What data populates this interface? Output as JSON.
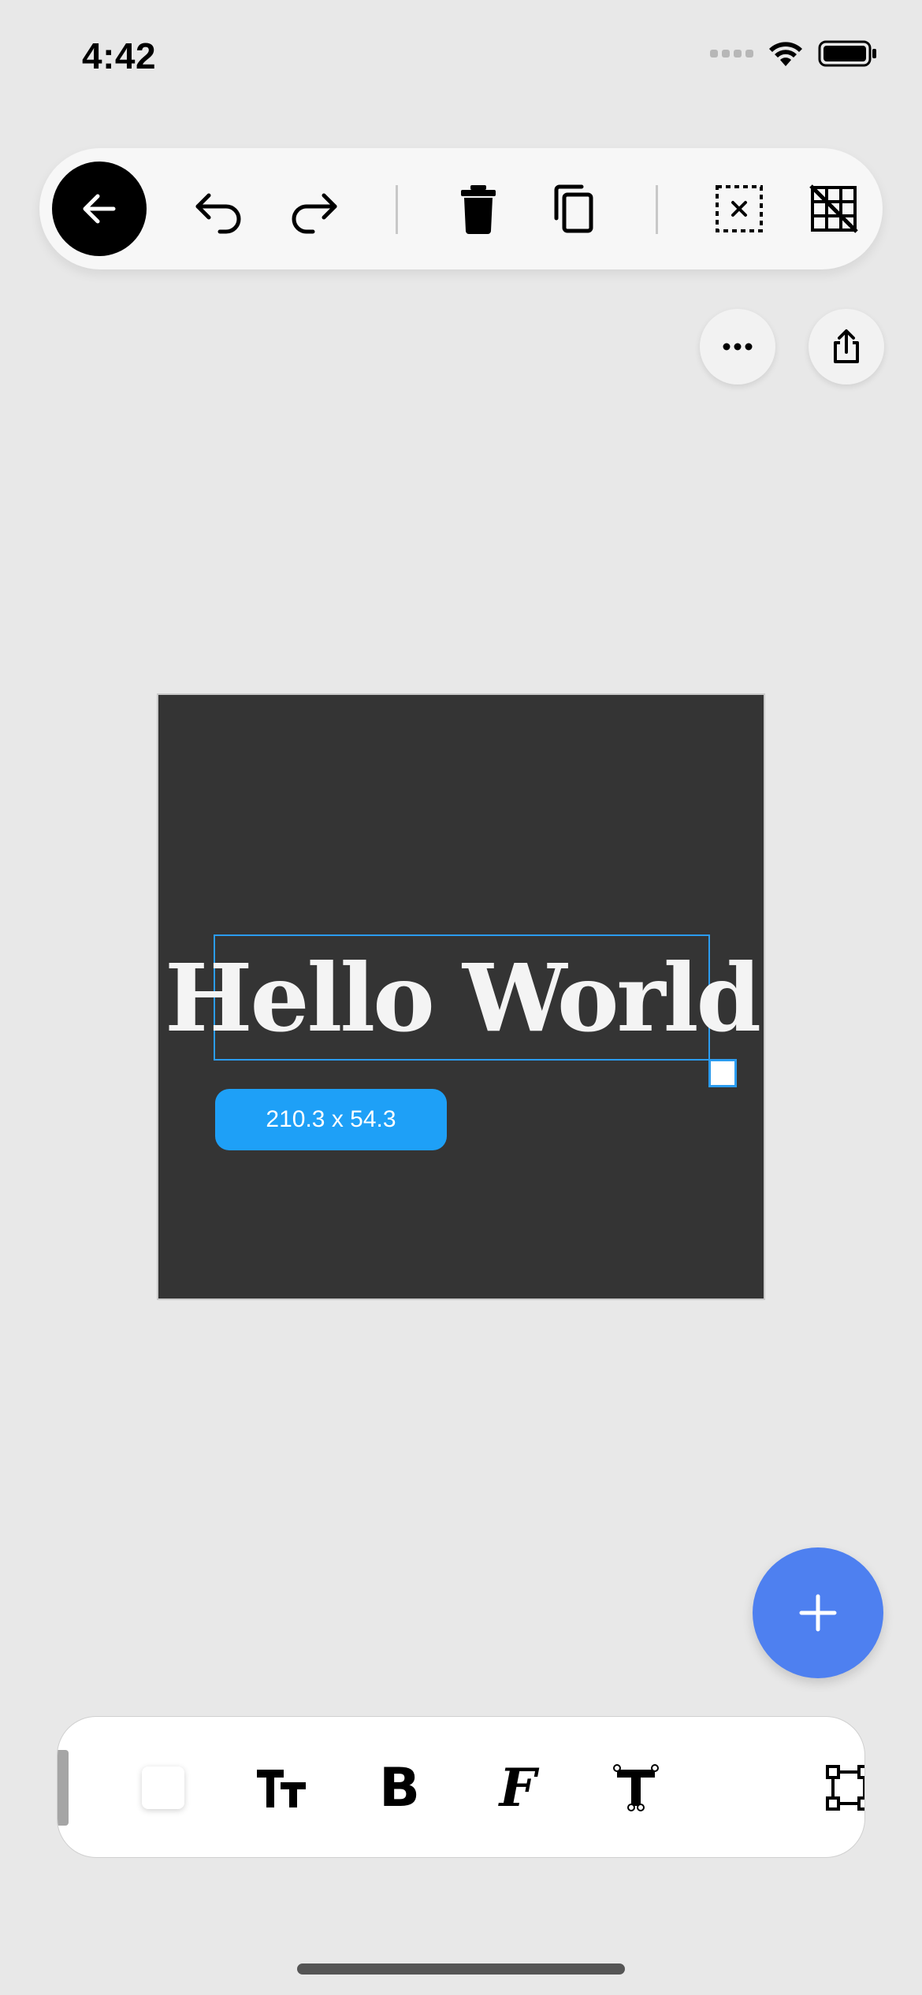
{
  "status_bar": {
    "time": "4:42"
  },
  "top_toolbar": {
    "items": [
      {
        "name": "back",
        "icon": "arrow-left-icon"
      },
      {
        "name": "undo",
        "icon": "undo-icon"
      },
      {
        "name": "redo",
        "icon": "redo-icon"
      },
      {
        "name": "delete",
        "icon": "trash-icon"
      },
      {
        "name": "duplicate",
        "icon": "copy-icon"
      },
      {
        "name": "deselect",
        "icon": "deselect-icon"
      },
      {
        "name": "grid-off",
        "icon": "grid-off-icon"
      }
    ]
  },
  "actions": {
    "more_icon": "ellipsis-icon",
    "share_icon": "share-icon"
  },
  "canvas": {
    "background": "#343434",
    "text_layer": {
      "text": "Hello World",
      "color": "#f4f4f4"
    },
    "selection_color": "#2b9cf0",
    "size_label": "210.3 x 54.3"
  },
  "fab": {
    "icon": "plus-icon",
    "color": "#4e80f0"
  },
  "bottom_toolbar": {
    "items": [
      {
        "name": "text-color",
        "icon": "color-swatch-icon"
      },
      {
        "name": "text-size",
        "icon": "text-size-icon",
        "glyph": "Tт"
      },
      {
        "name": "bold",
        "icon": "bold-icon",
        "glyph": "B"
      },
      {
        "name": "font",
        "icon": "font-icon",
        "glyph": "F"
      },
      {
        "name": "text-transform",
        "icon": "text-transform-icon",
        "glyph": "T"
      },
      {
        "name": "frame",
        "icon": "frame-icon"
      }
    ]
  }
}
